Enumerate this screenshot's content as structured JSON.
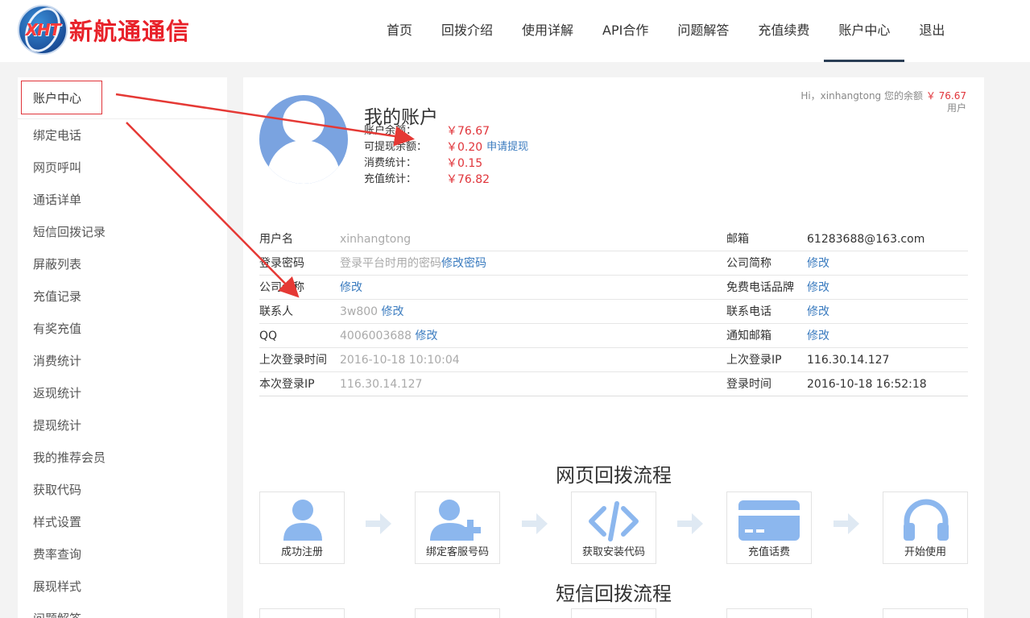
{
  "logo": {
    "text_en": "XHT",
    "text_cn": "新航通通信"
  },
  "nav": {
    "items": [
      {
        "label": "首页"
      },
      {
        "label": "回拨介绍"
      },
      {
        "label": "使用详解"
      },
      {
        "label": "API合作"
      },
      {
        "label": "问题解答"
      },
      {
        "label": "充值续费"
      },
      {
        "label": "账户中心"
      },
      {
        "label": "退出"
      }
    ],
    "active_index": 6
  },
  "sidebar": {
    "items": [
      {
        "label": "账户中心"
      },
      {
        "label": "绑定电话"
      },
      {
        "label": "网页呼叫"
      },
      {
        "label": "通话详单"
      },
      {
        "label": "短信回拨记录"
      },
      {
        "label": "屏蔽列表"
      },
      {
        "label": "充值记录"
      },
      {
        "label": "有奖充值"
      },
      {
        "label": "消费统计"
      },
      {
        "label": "返现统计"
      },
      {
        "label": "提现统计"
      },
      {
        "label": "我的推荐会员"
      },
      {
        "label": "获取代码"
      },
      {
        "label": "样式设置"
      },
      {
        "label": "费率查询"
      },
      {
        "label": "展现样式"
      },
      {
        "label": "问题解答"
      }
    ]
  },
  "account": {
    "title": "我的账户",
    "stats": [
      {
        "label": "账户余额：",
        "value": "￥76.67"
      },
      {
        "label": "可提现余额：",
        "value": "￥0.20",
        "link": "申请提现"
      },
      {
        "label": "消费统计：",
        "value": "￥0.15"
      },
      {
        "label": "充值统计：",
        "value": "￥76.82"
      }
    ],
    "greeting": {
      "prefix": "Hi，xinhangtong 您的余额",
      "amount": "￥ 76.67",
      "role": "用户"
    }
  },
  "info": {
    "rows": [
      {
        "l1": "用户名",
        "v1": "xinhangtong",
        "a1": "",
        "l2": "邮箱",
        "v2": "61283688@163.com",
        "a2": ""
      },
      {
        "l1": "登录密码",
        "v1": "登录平台时用的密码",
        "a1": "修改密码",
        "l2": "公司简称",
        "v2": "",
        "a2": "修改"
      },
      {
        "l1": "公司全称",
        "v1": "",
        "a1": "修改",
        "l2": "免费电话品牌",
        "v2": "",
        "a2": "修改"
      },
      {
        "l1": "联系人",
        "v1": "3w800 ",
        "a1": "修改",
        "l2": "联系电话",
        "v2": "",
        "a2": "修改"
      },
      {
        "l1": "QQ",
        "v1": "4006003688 ",
        "a1": "修改",
        "l2": "通知邮箱",
        "v2": "",
        "a2": "修改"
      },
      {
        "l1": "上次登录时间",
        "v1": "2016-10-18 10:10:04",
        "a1": "",
        "l2": "上次登录IP",
        "v2": "116.30.14.127",
        "a2": ""
      },
      {
        "l1": "本次登录IP",
        "v1": "116.30.14.127",
        "a1": "",
        "l2": "登录时间",
        "v2": "2016-10-18 16:52:18",
        "a2": ""
      }
    ]
  },
  "flows": {
    "web_title": "网页回拨流程",
    "web_steps": [
      {
        "label": "成功注册",
        "icon": "user-icon"
      },
      {
        "label": "绑定客服号码",
        "icon": "user-add-icon"
      },
      {
        "label": "获取安装代码",
        "icon": "code-icon"
      },
      {
        "label": "充值话费",
        "icon": "credit-card-icon"
      },
      {
        "label": "开始使用",
        "icon": "headset-icon"
      }
    ],
    "sms_title": "短信回拨流程"
  },
  "colors": {
    "accent_red": "#e0343a",
    "link_blue": "#3a7bbf",
    "icon_blue": "#8cb7ee",
    "nav_active": "#2a3e55"
  }
}
